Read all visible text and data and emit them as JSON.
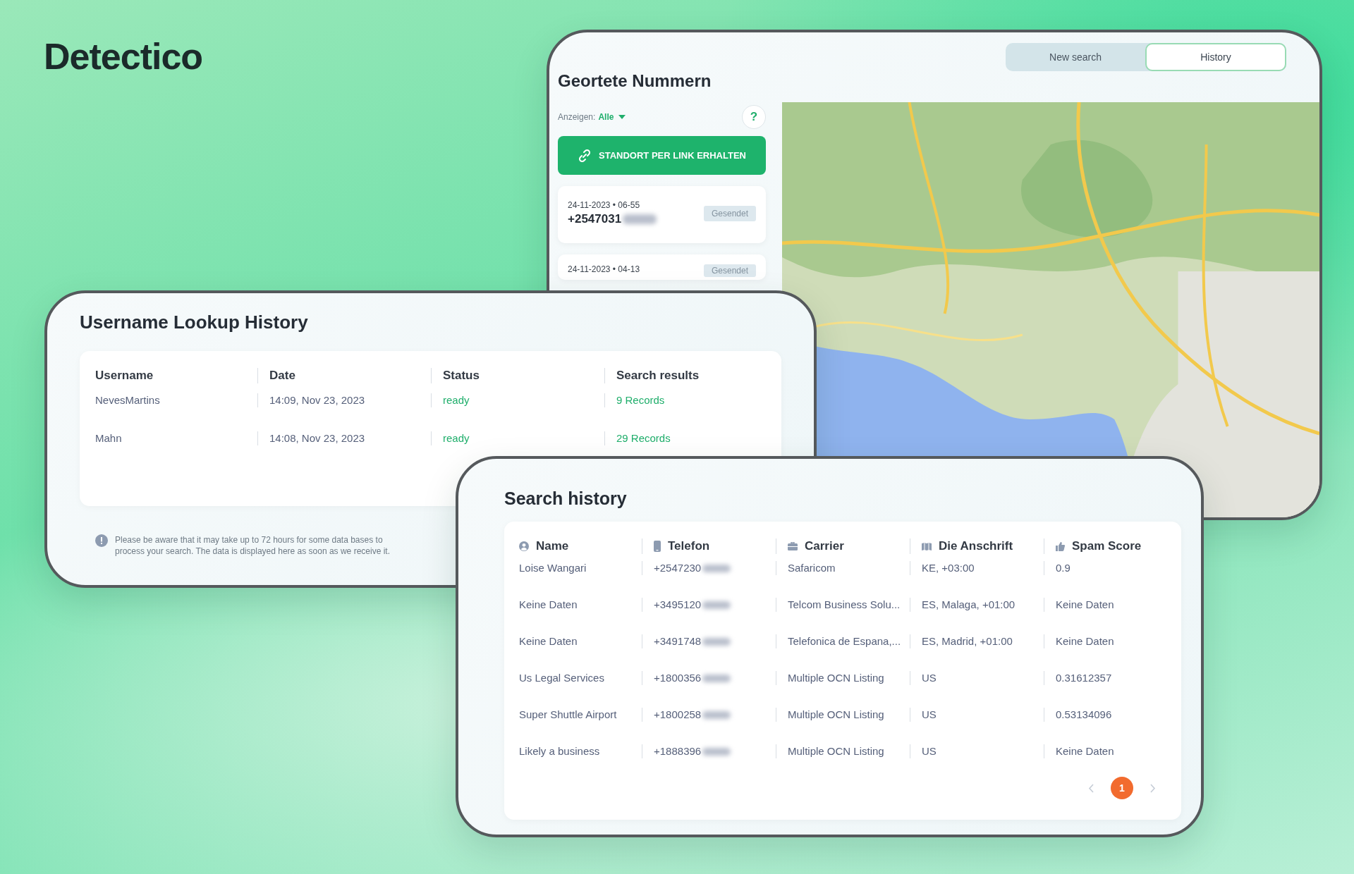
{
  "logo": {
    "text": "Detectico"
  },
  "geo_panel": {
    "tabs": [
      {
        "label": "New search",
        "selected": false
      },
      {
        "label": "History",
        "selected": true
      }
    ],
    "title": "Geortete Nummern",
    "filter": {
      "label": "Anzeigen:",
      "value": "Alle"
    },
    "help": "?",
    "button": "STANDORT PER LINK ERHALTEN",
    "cards": [
      {
        "datetime": "24-11-2023 • 06-55",
        "number": "+2547031",
        "status": "Gesendet"
      },
      {
        "datetime": "24-11-2023 • 04-13",
        "status": "Gesendet"
      }
    ]
  },
  "username_panel": {
    "title": "Username Lookup History",
    "columns": [
      "Username",
      "Date",
      "Status",
      "Search results"
    ],
    "rows": [
      {
        "cells": [
          "NevesMartins",
          "14:09, Nov 23, 2023",
          "ready",
          "9 Records"
        ]
      },
      {
        "cells": [
          "Mahn",
          "14:08, Nov 23, 2023",
          "ready",
          "29 Records"
        ]
      }
    ],
    "note": "Please be aware that it may take up to 72 hours for some data bases to process your search. The data is displayed here as soon as we receive it."
  },
  "search_panel": {
    "title": "Search history",
    "columns": [
      "Name",
      "Telefon",
      "Carrier",
      "Die Anschrift",
      "Spam Score"
    ],
    "rows": [
      {
        "cells": [
          "Loise Wangari",
          "+2547230",
          "Safaricom",
          "KE, +03:00",
          "0.9"
        ]
      },
      {
        "cells": [
          "Keine Daten",
          "+3495120",
          "Telcom Business Solu...",
          "ES, Malaga, +01:00",
          "Keine Daten"
        ]
      },
      {
        "cells": [
          "Keine Daten",
          "+3491748",
          "Telefonica de Espana,...",
          "ES, Madrid, +01:00",
          "Keine Daten"
        ]
      },
      {
        "cells": [
          "Us Legal Services",
          "+1800356",
          "Multiple OCN Listing",
          "US",
          "0.31612357"
        ]
      },
      {
        "cells": [
          "Super Shuttle Airport",
          "+1800258",
          "Multiple OCN Listing",
          "US",
          "0.53134096"
        ]
      },
      {
        "cells": [
          "Likely a business",
          "+1888396",
          "Multiple OCN Listing",
          "US",
          "Keine Daten"
        ]
      }
    ],
    "pages": [
      {
        "label": "1",
        "selected": true
      }
    ]
  }
}
